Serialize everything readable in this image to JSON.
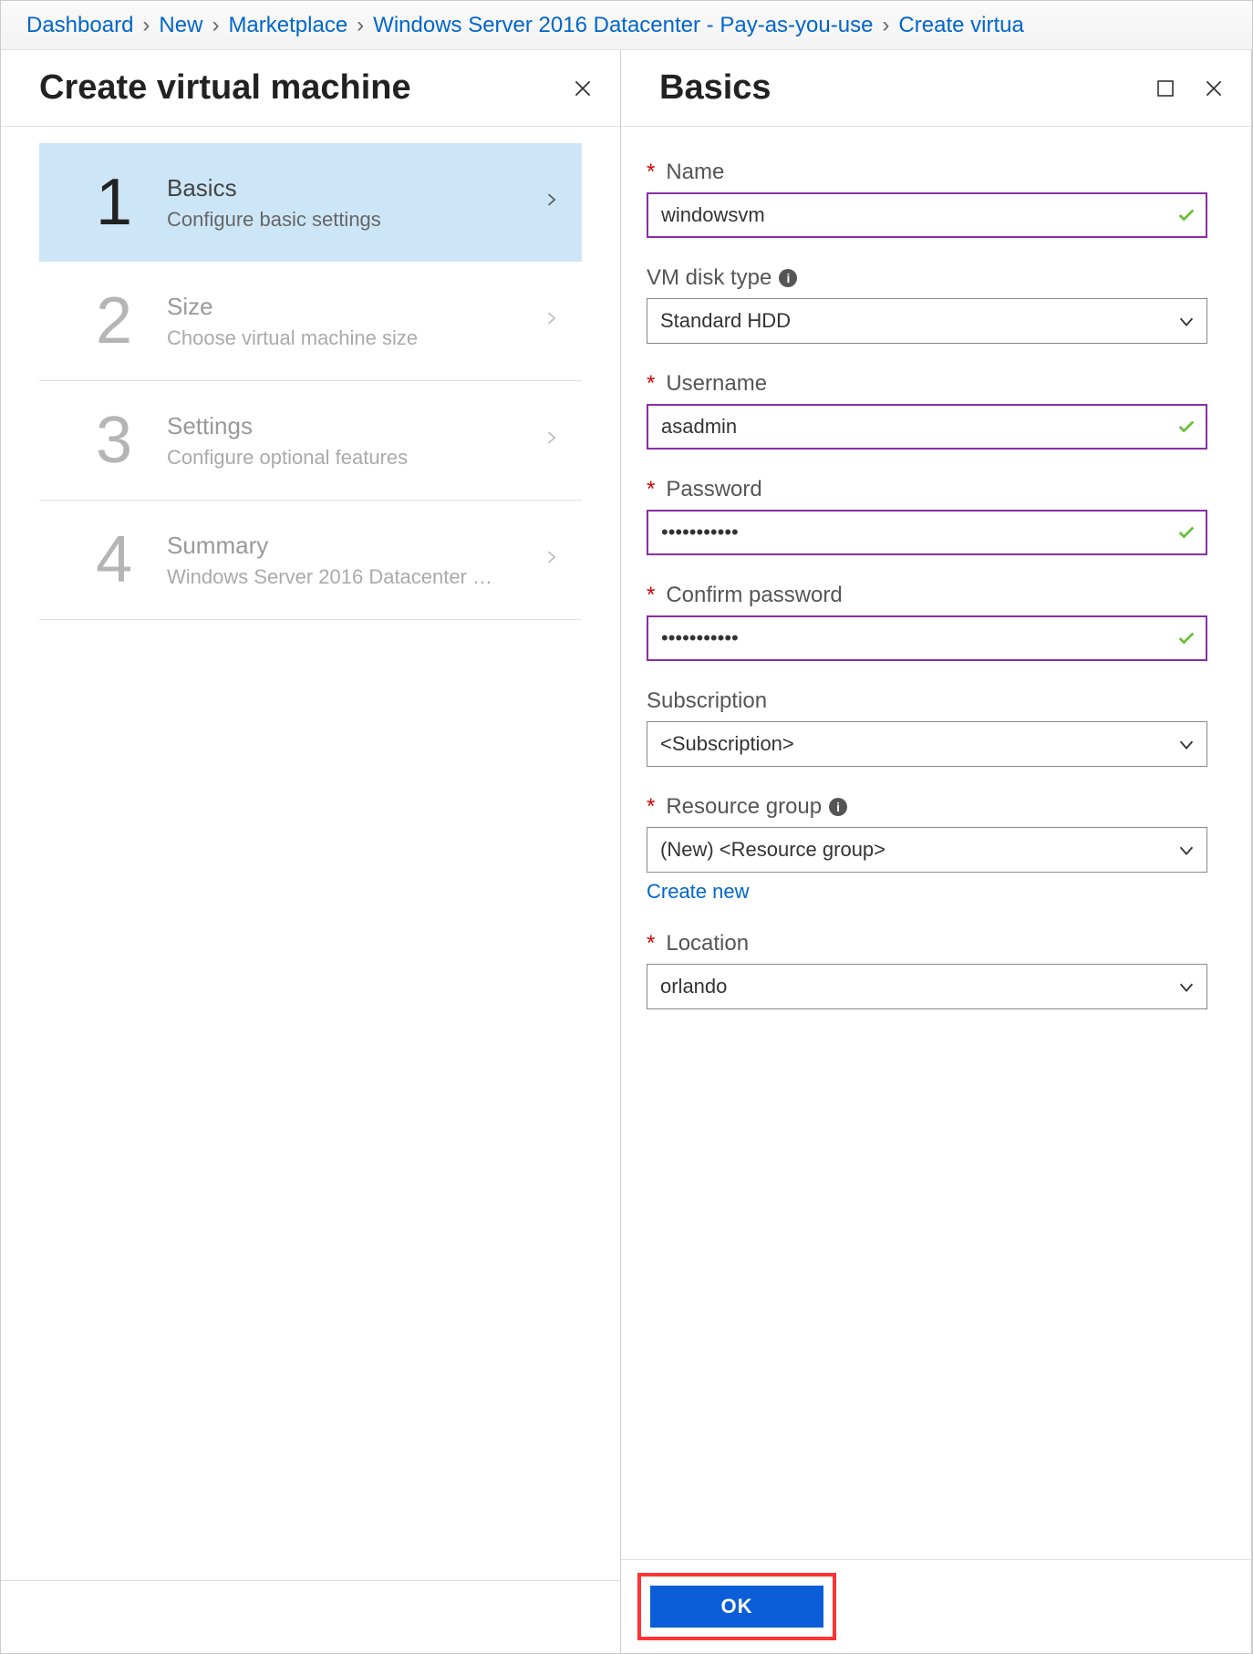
{
  "breadcrumb": {
    "items": [
      "Dashboard",
      "New",
      "Marketplace",
      "Windows Server 2016 Datacenter - Pay-as-you-use",
      "Create virtua"
    ]
  },
  "left": {
    "title": "Create virtual machine",
    "steps": [
      {
        "num": "1",
        "title": "Basics",
        "sub": "Configure basic settings",
        "active": true,
        "disabled": false
      },
      {
        "num": "2",
        "title": "Size",
        "sub": "Choose virtual machine size",
        "active": false,
        "disabled": true
      },
      {
        "num": "3",
        "title": "Settings",
        "sub": "Configure optional features",
        "active": false,
        "disabled": true
      },
      {
        "num": "4",
        "title": "Summary",
        "sub": "Windows Server 2016 Datacenter …",
        "active": false,
        "disabled": true
      }
    ]
  },
  "right": {
    "title": "Basics",
    "fields": {
      "name": {
        "label": "Name",
        "required": true,
        "value": "windowsvm",
        "validated": true
      },
      "disk_type": {
        "label": "VM disk type",
        "required": false,
        "value": "Standard HDD",
        "info": true
      },
      "username": {
        "label": "Username",
        "required": true,
        "value": "asadmin",
        "validated": true
      },
      "password": {
        "label": "Password",
        "required": true,
        "value": "•••••••••••",
        "validated": true
      },
      "confirm": {
        "label": "Confirm password",
        "required": true,
        "value": "•••••••••••",
        "validated": true
      },
      "subscription": {
        "label": "Subscription",
        "required": false,
        "value": "<Subscription>"
      },
      "resource_group": {
        "label": "Resource group",
        "required": true,
        "value": "(New)  <Resource group>",
        "info": true,
        "link": "Create new"
      },
      "location": {
        "label": "Location",
        "required": true,
        "value": "orlando"
      }
    },
    "ok_label": "OK"
  }
}
